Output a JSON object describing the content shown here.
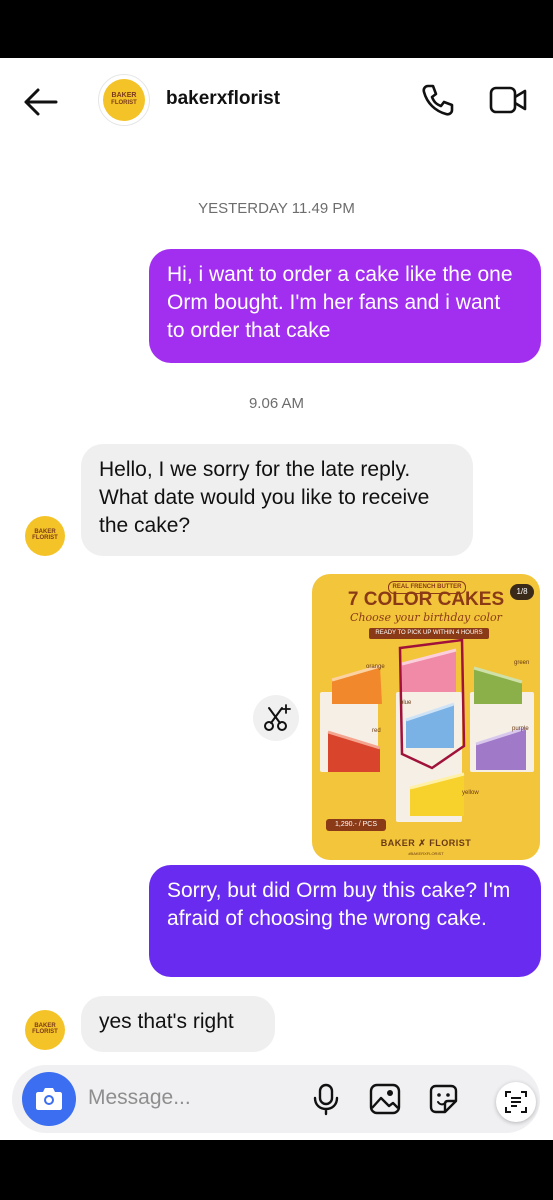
{
  "header": {
    "username": "bakerxflorist",
    "logo_line1": "BAKER",
    "logo_line2": "FLORIST",
    "back_icon": "arrow-left-icon",
    "call_icon": "phone-icon",
    "video_icon": "video-camera-icon"
  },
  "timestamps": [
    "YESTERDAY 11.49 PM",
    "9.06 AM"
  ],
  "messages": [
    {
      "from": "me",
      "text": "Hi, i want to order a cake like the one Orm bought. I'm her fans and i want to order that cake",
      "color": "#a22ff0"
    },
    {
      "from": "them",
      "text": "Hello, I we sorry for the late reply. What date would you like to receive the cake?"
    },
    {
      "from": "me",
      "type": "image"
    },
    {
      "from": "me",
      "text": "Sorry, but did Orm buy this cake? I'm afraid of choosing the wrong cake.",
      "color": "#6a2bf0"
    },
    {
      "from": "them",
      "text": "yes that's right"
    }
  ],
  "cake_image": {
    "tag": "REAL FRENCH BUTTER",
    "counter": "1/8",
    "headline": "7 COLOR CAKES",
    "subtitle": "Choose your birthday color",
    "ribbon": "READY TO PICK UP WITHIN 4 HOURS",
    "colors": [
      "orange",
      "pink",
      "green",
      "blue",
      "red",
      "purple",
      "yellow"
    ],
    "price": "1,290.- / PCS",
    "brand": "BAKER ✗ FLORIST",
    "brand_handle": "#BAKERXFLORIST"
  },
  "image_action_icon": "scissors-sparkle-icon",
  "composer": {
    "placeholder": "Message...",
    "camera_icon": "camera-icon",
    "mic_icon": "microphone-icon",
    "gallery_icon": "image-icon",
    "sticker_icon": "sticker-icon",
    "scan_icon": "text-scan-icon"
  }
}
